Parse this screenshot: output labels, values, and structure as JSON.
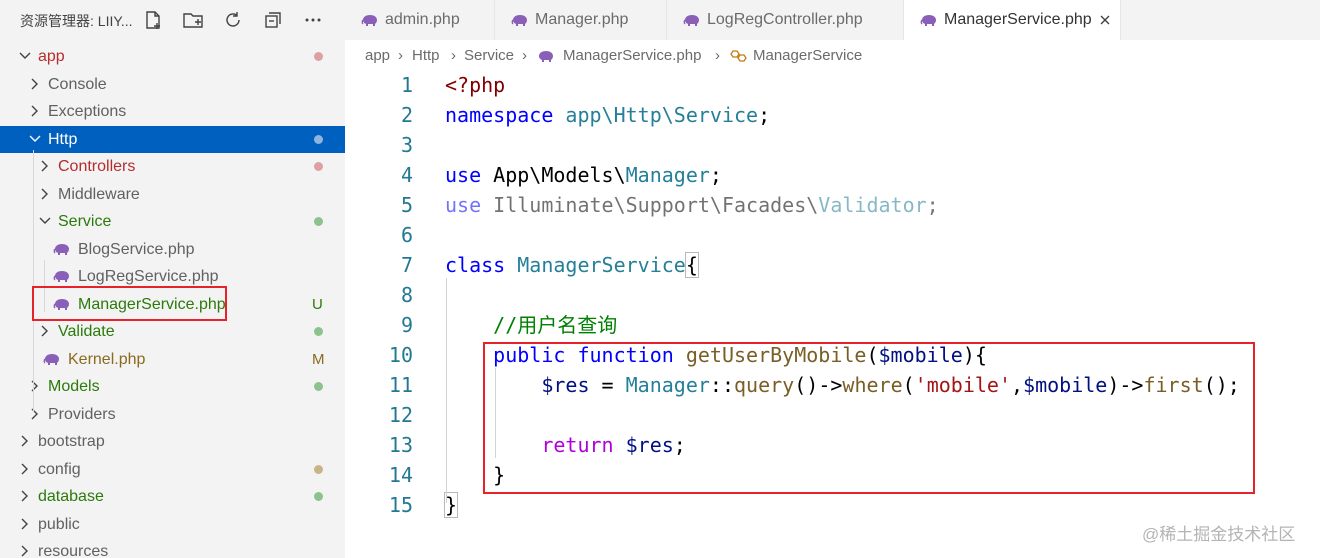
{
  "sidebar": {
    "title": "资源管理器: LIIY...",
    "actions": [
      "new-file-icon",
      "new-folder-icon",
      "refresh-icon",
      "collapse-all-icon",
      "more-icon"
    ],
    "items": [
      {
        "label": "app",
        "indent": 0,
        "type": "folder",
        "expanded": true,
        "color": "red",
        "status": "dot",
        "status_color": "#e0a0a0"
      },
      {
        "label": "Console",
        "indent": 1,
        "type": "folder",
        "expanded": false,
        "color": "default"
      },
      {
        "label": "Exceptions",
        "indent": 1,
        "type": "folder",
        "expanded": false,
        "color": "default"
      },
      {
        "label": "Http",
        "indent": 1,
        "type": "folder",
        "expanded": true,
        "color": "white",
        "selected": true,
        "status": "dot",
        "status_color": "#8fb4e0"
      },
      {
        "label": "Controllers",
        "indent": 2,
        "type": "folder",
        "expanded": false,
        "color": "red",
        "status": "dot",
        "status_color": "#e0a0a0"
      },
      {
        "label": "Middleware",
        "indent": 2,
        "type": "folder",
        "expanded": false,
        "color": "default"
      },
      {
        "label": "Service",
        "indent": 2,
        "type": "folder",
        "expanded": true,
        "color": "green",
        "status": "dot",
        "status_color": "#8cc28c"
      },
      {
        "label": "BlogService.php",
        "indent": 3,
        "type": "php",
        "color": "default"
      },
      {
        "label": "LogRegService.php",
        "indent": 3,
        "type": "php",
        "color": "default"
      },
      {
        "label": "ManagerService.php",
        "indent": 3,
        "type": "php",
        "color": "green",
        "status": "badge",
        "badge": "U",
        "badge_color": "#2b7a0b"
      },
      {
        "label": "Validate",
        "indent": 2,
        "type": "folder",
        "expanded": false,
        "color": "green",
        "status": "dot",
        "status_color": "#8cc28c"
      },
      {
        "label": "Kernel.php",
        "indent": 2,
        "type": "php",
        "color": "olive",
        "status": "badge",
        "badge": "M",
        "badge_color": "#8a6a1e"
      },
      {
        "label": "Models",
        "indent": 1,
        "type": "folder",
        "expanded": false,
        "color": "green",
        "status": "dot",
        "status_color": "#8cc28c"
      },
      {
        "label": "Providers",
        "indent": 1,
        "type": "folder",
        "expanded": false,
        "color": "default"
      },
      {
        "label": "bootstrap",
        "indent": 0,
        "type": "folder",
        "expanded": false,
        "color": "default"
      },
      {
        "label": "config",
        "indent": 0,
        "type": "folder",
        "expanded": false,
        "color": "default",
        "status": "dot",
        "status_color": "#c9b48a"
      },
      {
        "label": "database",
        "indent": 0,
        "type": "folder",
        "expanded": false,
        "color": "green",
        "status": "dot",
        "status_color": "#8cc28c"
      },
      {
        "label": "public",
        "indent": 0,
        "type": "folder",
        "expanded": false,
        "color": "default"
      },
      {
        "label": "resources",
        "indent": 0,
        "type": "folder",
        "expanded": false,
        "color": "default"
      }
    ]
  },
  "tabs": [
    {
      "label": "admin.php",
      "active": false
    },
    {
      "label": "Manager.php",
      "active": false
    },
    {
      "label": "LogRegController.php",
      "active": false
    },
    {
      "label": "ManagerService.php",
      "active": true,
      "close_icon": "close-icon"
    }
  ],
  "breadcrumb": [
    "app",
    "Http",
    "Service",
    "ManagerService.php",
    "ManagerService"
  ],
  "code": {
    "line_numbers": [
      "1",
      "2",
      "3",
      "4",
      "5",
      "6",
      "7",
      "8",
      "9",
      "10",
      "11",
      "12",
      "13",
      "14",
      "15"
    ],
    "lines": [
      [
        {
          "t": "<?php",
          "c": "tag"
        }
      ],
      [
        {
          "t": "namespace ",
          "c": "kw"
        },
        {
          "t": "app\\Http\\Service",
          "c": "cls"
        },
        {
          "t": ";",
          "c": ""
        }
      ],
      [],
      [
        {
          "t": "use ",
          "c": "kw"
        },
        {
          "t": "App\\Models\\",
          "c": ""
        },
        {
          "t": "Manager",
          "c": "cls"
        },
        {
          "t": ";",
          "c": ""
        }
      ],
      [
        {
          "t": "use ",
          "c": "kw dim"
        },
        {
          "t": "Illuminate\\Support\\Facades\\",
          "c": "dim"
        },
        {
          "t": "Validator",
          "c": "cls dim"
        },
        {
          "t": ";",
          "c": "dim"
        }
      ],
      [],
      [
        {
          "t": "class ",
          "c": "kw"
        },
        {
          "t": "ManagerService",
          "c": "cls"
        },
        {
          "t": "{",
          "c": "brace"
        }
      ],
      [],
      [
        {
          "t": "    ",
          "c": ""
        },
        {
          "t": "//用户名查询",
          "c": "cmt"
        }
      ],
      [
        {
          "t": "    ",
          "c": ""
        },
        {
          "t": "public ",
          "c": "kw"
        },
        {
          "t": "function ",
          "c": "kw"
        },
        {
          "t": "getUserByMobile",
          "c": "fn"
        },
        {
          "t": "(",
          "c": ""
        },
        {
          "t": "$mobile",
          "c": "var"
        },
        {
          "t": "){",
          "c": ""
        }
      ],
      [
        {
          "t": "        ",
          "c": ""
        },
        {
          "t": "$res",
          "c": "var"
        },
        {
          "t": " = ",
          "c": ""
        },
        {
          "t": "Manager",
          "c": "cls"
        },
        {
          "t": "::",
          "c": ""
        },
        {
          "t": "query",
          "c": "fn"
        },
        {
          "t": "()->",
          "c": ""
        },
        {
          "t": "where",
          "c": "fn"
        },
        {
          "t": "(",
          "c": ""
        },
        {
          "t": "'mobile'",
          "c": "str"
        },
        {
          "t": ",",
          "c": ""
        },
        {
          "t": "$mobile",
          "c": "var"
        },
        {
          "t": ")->",
          "c": ""
        },
        {
          "t": "first",
          "c": "fn"
        },
        {
          "t": "();",
          "c": ""
        }
      ],
      [],
      [
        {
          "t": "        ",
          "c": ""
        },
        {
          "t": "return ",
          "c": "ctl"
        },
        {
          "t": "$res",
          "c": "var"
        },
        {
          "t": ";",
          "c": ""
        }
      ],
      [
        {
          "t": "    ",
          "c": ""
        },
        {
          "t": "}",
          "c": ""
        }
      ],
      [
        {
          "t": "}",
          "c": "brace"
        }
      ]
    ]
  },
  "watermark": "@稀土掘金技术社区",
  "colors": {
    "accent": "#0060c0",
    "highlight": "#e8222b",
    "php_icon": "#8a5fb8"
  }
}
